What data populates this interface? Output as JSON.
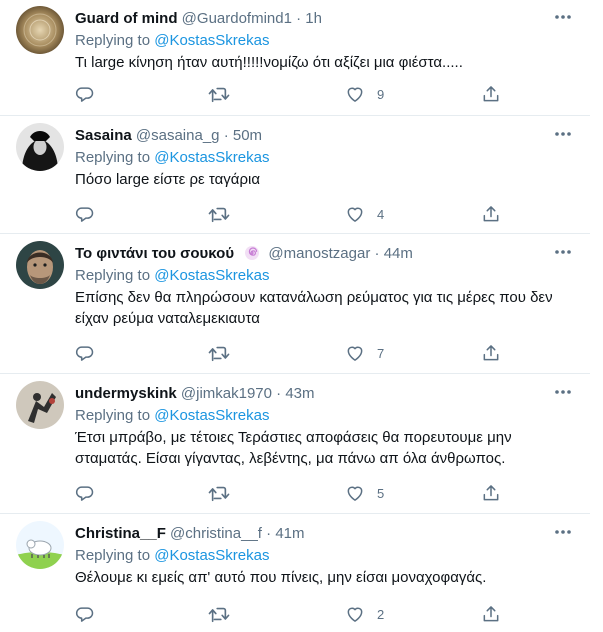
{
  "tweets": [
    {
      "name": "Guard of mind",
      "handle": "@Guardofmind1",
      "separator": "·",
      "time": "1h",
      "replying_prefix": "Replying to",
      "replying_to": "@KostasSkrekas",
      "text": "Τι large κίνηση ήταν αυτή!!!!!νομίζω ότι αξίζει μια φιέστα.....",
      "like_count": "9",
      "avatar_colors": [
        "#9a8257",
        "#d9c8a4"
      ]
    },
    {
      "name": "Sasaina",
      "handle": "@sasaina_g",
      "separator": "·",
      "time": "50m",
      "replying_prefix": "Replying to",
      "replying_to": "@KostasSkrekas",
      "text": "Πόσο large είστε ρε ταγάρια",
      "like_count": "4",
      "avatar_colors": [
        "#1a1a1a",
        "#d8d8d8"
      ]
    },
    {
      "name": "Το φιντάνι του σουκού",
      "handle": "@manostzagar",
      "separator": "·",
      "time": "44m",
      "replying_prefix": "Replying to",
      "replying_to": "@KostasSkrekas",
      "text": "Επίσης δεν θα πληρώσουν  κατανάλωση ρεύματος για τις μέρες που δεν είχαν ρεύμα ναταλεμεκιαυτα",
      "like_count": "7",
      "avatar_colors": [
        "#2f4a4a",
        "#c7a98a"
      ]
    },
    {
      "name": "undermyskink",
      "handle": "@jimkak1970",
      "separator": "·",
      "time": "43m",
      "replying_prefix": "Replying to",
      "replying_to": "@KostasSkrekas",
      "text": "Έτσι μπράβο, με τέτοιες Τεράστιες αποφάσεις θα πορευτουμε μην σταματάς. Είσαι γίγαντας, λεβέντης, μα πάνω απ όλα άνθρωπος.",
      "like_count": "5",
      "avatar_colors": [
        "#c9c2b6",
        "#3a3a3a"
      ]
    },
    {
      "name": "Christina__F",
      "handle": "@christina__f",
      "separator": "·",
      "time": "41m",
      "replying_prefix": "Replying to",
      "replying_to": "@KostasSkrekas",
      "text": "Θέλουμε κι εμείς απ' αυτό που πίνεις, μην είσαι μοναχοφαγάς.",
      "like_count": "2",
      "avatar_colors": [
        "#8fd14f",
        "#e8f4ff"
      ]
    }
  ],
  "icons": {
    "reply": "reply-icon",
    "retweet": "retweet-icon",
    "like": "heart-icon",
    "share": "share-icon",
    "more": "more-dots-icon",
    "badge": "spiral-badge-icon"
  },
  "colors": {
    "text": "#0f1419",
    "secondary": "#5b7083",
    "link": "#1b95e0",
    "divider": "#e6ecf0",
    "badge": "#c77dd4"
  }
}
